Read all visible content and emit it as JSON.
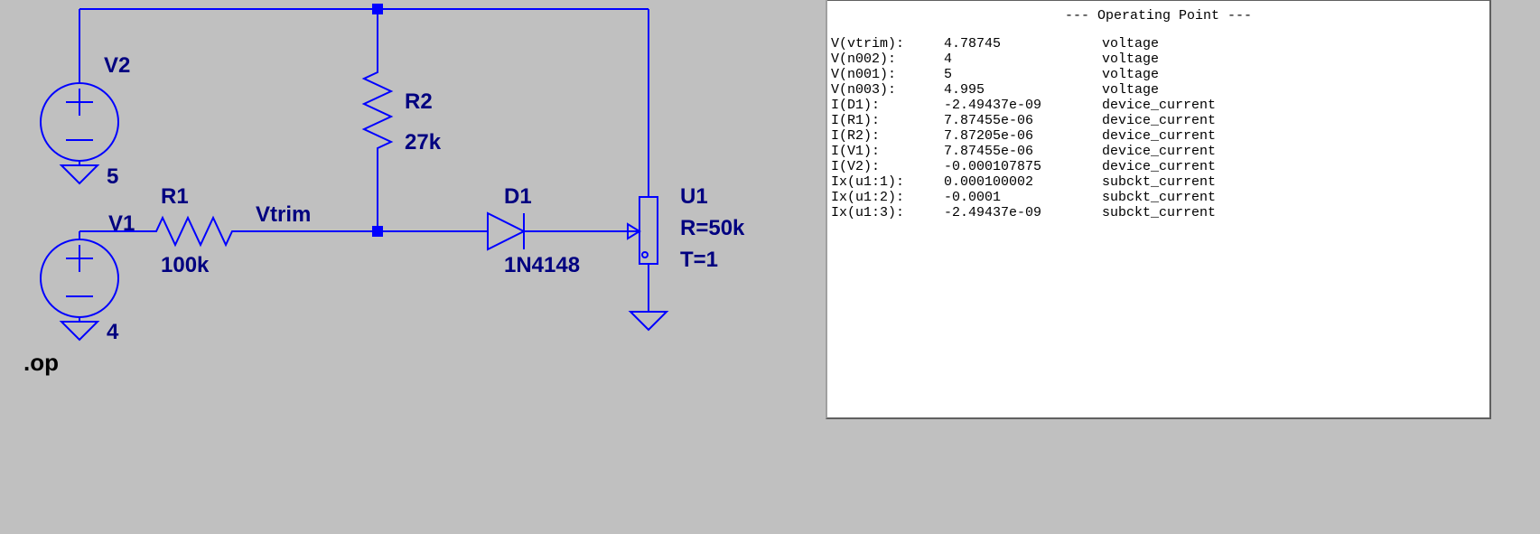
{
  "schematic": {
    "V2": {
      "ref": "V2",
      "value": "5"
    },
    "V1": {
      "ref": "V1",
      "value": "4"
    },
    "R1": {
      "ref": "R1",
      "value": "100k"
    },
    "R2": {
      "ref": "R2",
      "value": "27k"
    },
    "D1": {
      "ref": "D1",
      "value": "1N4148"
    },
    "U1": {
      "ref": "U1",
      "param1": "R=50k",
      "param2": "T=1"
    },
    "net_vtrim": "Vtrim",
    "directive": ".op"
  },
  "results": {
    "title": "--- Operating Point ---",
    "rows": [
      {
        "name": "V(vtrim):",
        "value": "4.78745",
        "type": "voltage"
      },
      {
        "name": "V(n002):",
        "value": "4",
        "type": "voltage"
      },
      {
        "name": "V(n001):",
        "value": "5",
        "type": "voltage"
      },
      {
        "name": "V(n003):",
        "value": "4.995",
        "type": "voltage"
      },
      {
        "name": "I(D1):",
        "value": "-2.49437e-09",
        "type": "device_current"
      },
      {
        "name": "I(R1):",
        "value": "7.87455e-06",
        "type": "device_current"
      },
      {
        "name": "I(R2):",
        "value": "7.87205e-06",
        "type": "device_current"
      },
      {
        "name": "I(V1):",
        "value": "7.87455e-06",
        "type": "device_current"
      },
      {
        "name": "I(V2):",
        "value": "-0.000107875",
        "type": "device_current"
      },
      {
        "name": "Ix(u1:1):",
        "value": "0.000100002",
        "type": "subckt_current"
      },
      {
        "name": "Ix(u1:2):",
        "value": "-0.0001",
        "type": "subckt_current"
      },
      {
        "name": "Ix(u1:3):",
        "value": "-2.49437e-09",
        "type": "subckt_current"
      }
    ]
  }
}
